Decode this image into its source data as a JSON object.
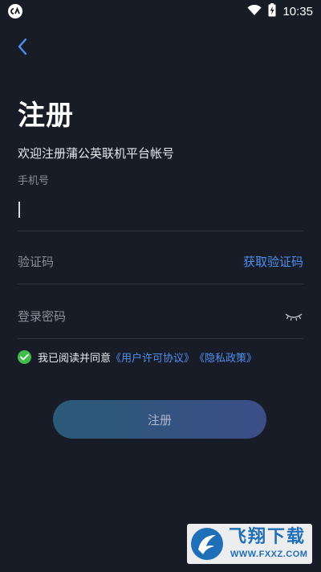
{
  "status_bar": {
    "time": "10:35",
    "app_icon": "app-badge-icon",
    "wifi_icon": "wifi-icon",
    "battery_icon": "battery-charging-icon"
  },
  "header": {
    "back_icon": "chevron-left-icon",
    "title": "注册",
    "subtitle": "欢迎注册蒲公英联机平台帐号"
  },
  "form": {
    "phone": {
      "label": "手机号",
      "value": "",
      "placeholder": ""
    },
    "code": {
      "placeholder": "验证码",
      "get_code_label": "获取验证码"
    },
    "password": {
      "placeholder": "登录密码",
      "toggle_icon": "eye-closed-icon"
    },
    "agreement": {
      "checked": true,
      "text": "我已阅读并同意",
      "user_agreement_link": "《用户许可协议》",
      "privacy_link": "《隐私政策》"
    },
    "submit_label": "注册"
  },
  "watermark": {
    "title": "飞翔下载",
    "url": "WWW.FXXZ.COM"
  },
  "colors": {
    "background": "#181c27",
    "accent_link": "#4e8ff0",
    "check_green": "#3fbf4a",
    "button_gradient_start": "#2a5a78",
    "button_gradient_end": "#3c4e86"
  }
}
